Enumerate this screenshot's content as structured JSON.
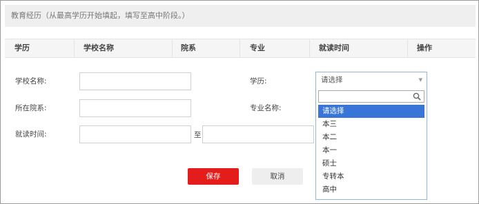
{
  "section": {
    "title": "教育经历（从最高学历开始填起，填写至高中阶段。）"
  },
  "table": {
    "headers": [
      "学历",
      "学校名称",
      "院系",
      "专业",
      "就读时间",
      "操作"
    ]
  },
  "form": {
    "school_label": "学校名称:",
    "department_label": "所在院系:",
    "period_label": "就读时间:",
    "to_label": "至",
    "degree_label": "学历:",
    "major_label": "专业名称:"
  },
  "degree_select": {
    "selected": "请选择",
    "options": [
      "请选择",
      "本三",
      "本二",
      "本一",
      "硕士",
      "专转本",
      "高中"
    ]
  },
  "buttons": {
    "save": "保存",
    "cancel": "取消"
  },
  "colors": {
    "save_button": "#e51c1c",
    "active_option": "#3875d7",
    "select_border": "#8fb4e6"
  }
}
